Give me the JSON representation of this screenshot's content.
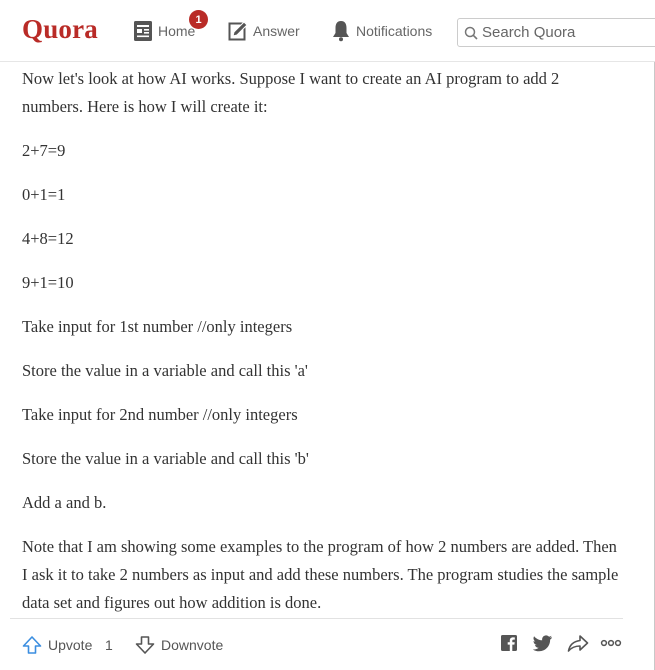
{
  "header": {
    "logo": "Quora",
    "nav": {
      "home_label": "Home",
      "home_badge": "1",
      "answer_label": "Answer",
      "notifications_label": "Notifications"
    },
    "search": {
      "placeholder": "Search Quora"
    }
  },
  "answer": {
    "paragraphs": [
      "Now let's look at how AI works. Suppose I want to create an AI program to add 2 numbers. Here is how I will create it:",
      "2+7=9",
      "0+1=1",
      "4+8=12",
      "9+1=10",
      "Take input for 1st number //only integers",
      "Store the value in a variable and call this 'a'",
      "Take input for 2nd number //only integers",
      "Store the value in a variable and call this 'b'",
      "Add a and b.",
      "Note that I am showing some examples to the program of how 2 numbers are added. Then I ask it to take 2 numbers as input and add these numbers. The program studies the sample data set and figures out how addition is done."
    ]
  },
  "actions": {
    "upvote_label": "Upvote",
    "upvote_count": "1",
    "downvote_label": "Downvote"
  },
  "colors": {
    "brand": "#b92b27",
    "text": "#333333",
    "muted": "#666666"
  },
  "icons": [
    "home-icon",
    "answer-pencil-icon",
    "bell-icon",
    "search-icon",
    "upvote-arrow-icon",
    "downvote-arrow-icon",
    "facebook-icon",
    "twitter-icon",
    "share-arrow-icon",
    "more-dots-icon"
  ]
}
